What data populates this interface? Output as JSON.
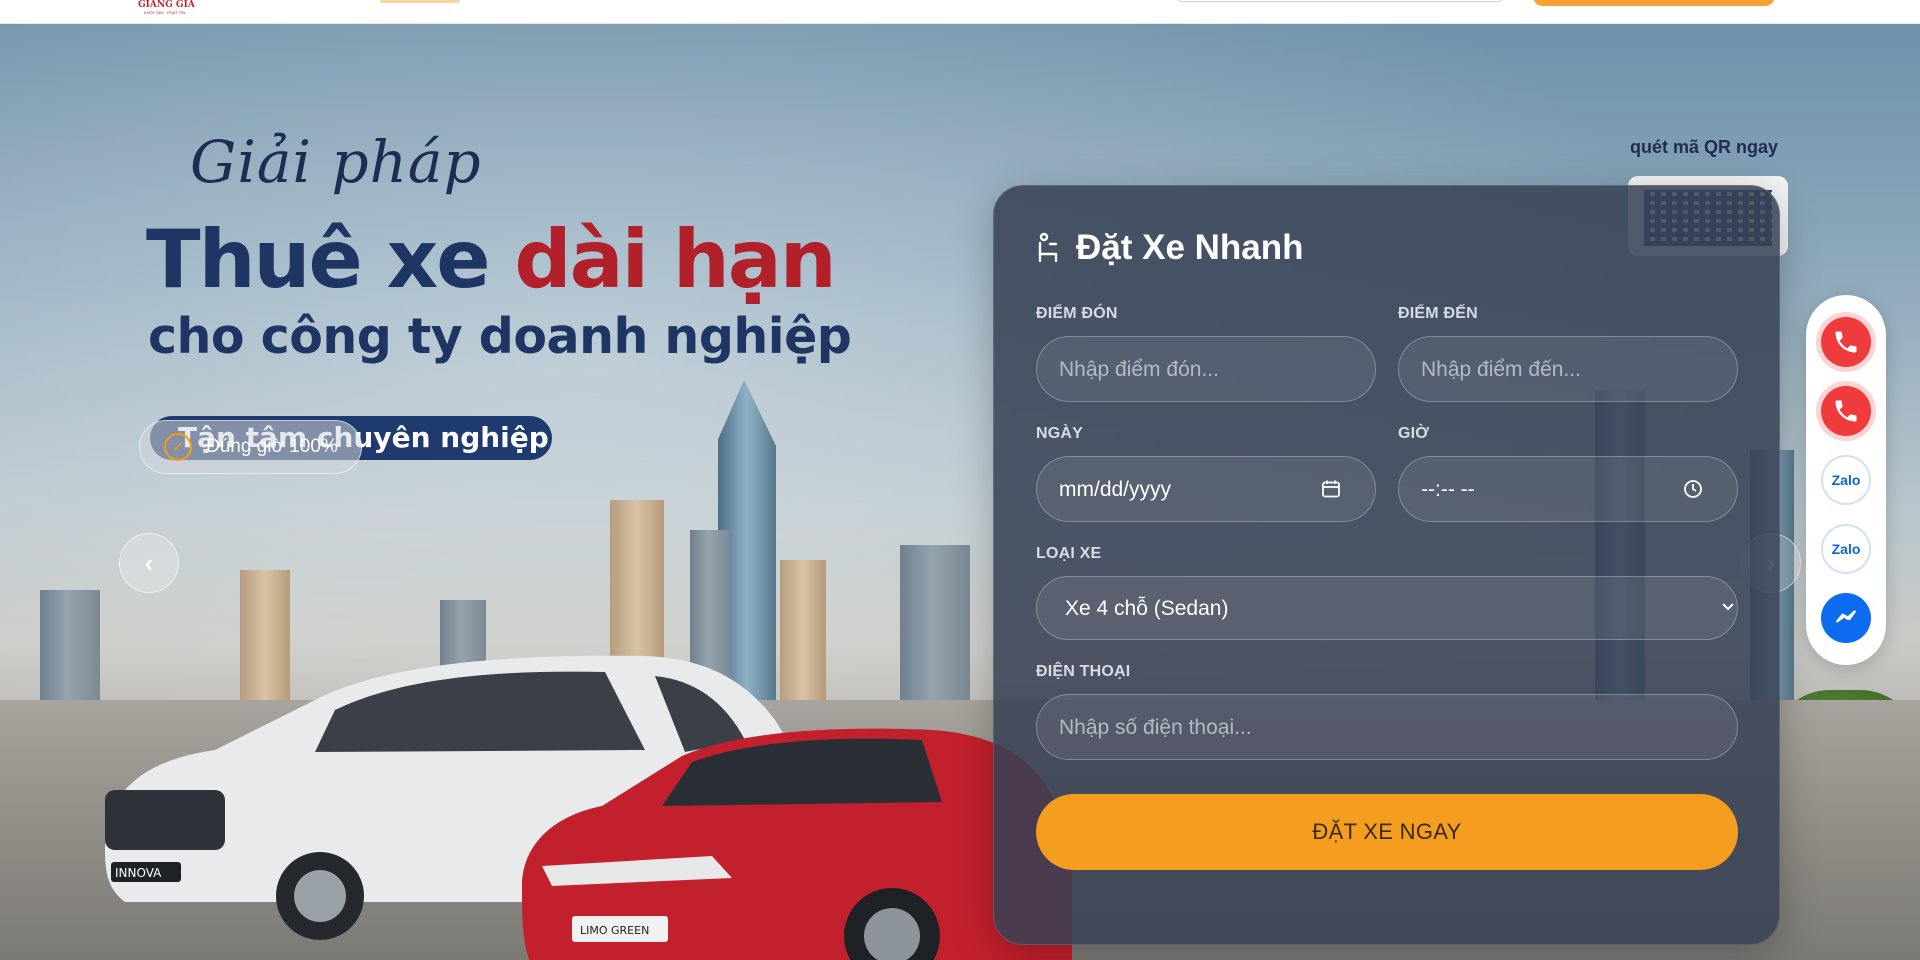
{
  "header": {
    "logo_text": "GIANG GIA",
    "logo_tagline": "KHỞI TÂM · PHÁT TÍN"
  },
  "hero": {
    "script_text": "Giải pháp",
    "headline_part1": "Thuê xe",
    "headline_part2": "dài hạn",
    "subline": "cho công ty doanh nghiệp",
    "pill_text": "Tận tâm chuyên nghiệp",
    "badge_text": "Đúng giờ 100%",
    "qr_caption": "quét mã QR ngay",
    "car_plate_white": "INNOVA",
    "car_plate_red": "LIMO GREEN"
  },
  "booking": {
    "title": "Đặt Xe Nhanh",
    "pickup_label": "ĐIỂM ĐÓN",
    "pickup_placeholder": "Nhập điểm đón...",
    "dropoff_label": "ĐIỂM ĐẾN",
    "dropoff_placeholder": "Nhập điểm đến...",
    "date_label": "NGÀY",
    "date_value": "mm/dd/yyyy",
    "time_label": "GIỜ",
    "time_value": "--:-- --",
    "car_type_label": "LOẠI XE",
    "car_type_value": "Xe 4 chỗ (Sedan)",
    "phone_label": "ĐIỆN THOẠI",
    "phone_placeholder": "Nhập số điện thoại...",
    "submit_label": "ĐẶT XE NGAY"
  },
  "contact_rail": {
    "zalo_1": "Zalo",
    "zalo_2": "Zalo"
  },
  "icons": {
    "check": "check-circle-icon",
    "phone": "phone-icon",
    "messenger": "messenger-icon",
    "calendar": "calendar-icon",
    "clock": "clock-icon",
    "chevron": "chevron-down-icon"
  },
  "colors": {
    "brand_navy": "#1f3564",
    "brand_red": "#b2202a",
    "accent_orange": "#f59d1e",
    "card_bg": "#374054"
  }
}
